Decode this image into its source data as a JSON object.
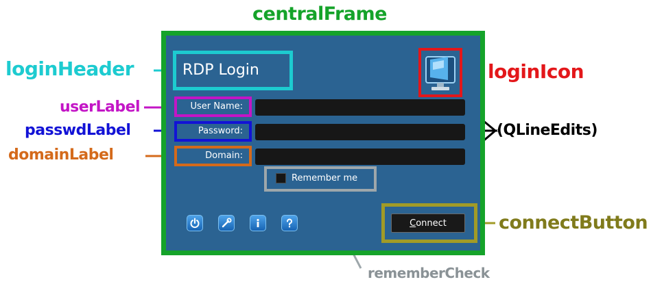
{
  "annotations": {
    "central_frame": "centralFrame",
    "login_header": "loginHeader",
    "login_icon": "loginIcon",
    "user_label": "userLabel",
    "passwd_label": "passwdLabel",
    "domain_label": "domainLabel",
    "line_edits": "(QLineEdits)",
    "connect_button": "connectButton",
    "remember_check": "rememberCheck"
  },
  "dialog": {
    "title": "RDP Login",
    "user_label": "User Name:",
    "password_label": "Password:",
    "domain_label": "Domain:",
    "user_value": "",
    "password_value": "",
    "domain_value": "",
    "remember_label": "Remember me",
    "remember_checked": false,
    "connect_label_first": "C",
    "connect_label_rest": "onnect",
    "toolbar_icons": [
      "power-icon",
      "wrench-icon",
      "info-icon",
      "help-icon"
    ]
  },
  "colors": {
    "frame": "#15a32a",
    "header": "#1dcbd0",
    "icon": "#e3171a",
    "user": "#c315c6",
    "password": "#1212d6",
    "domain": "#d46a1b",
    "remember": "#9ea7ab",
    "connect": "#a19b27",
    "window_bg": "#2b6392"
  }
}
